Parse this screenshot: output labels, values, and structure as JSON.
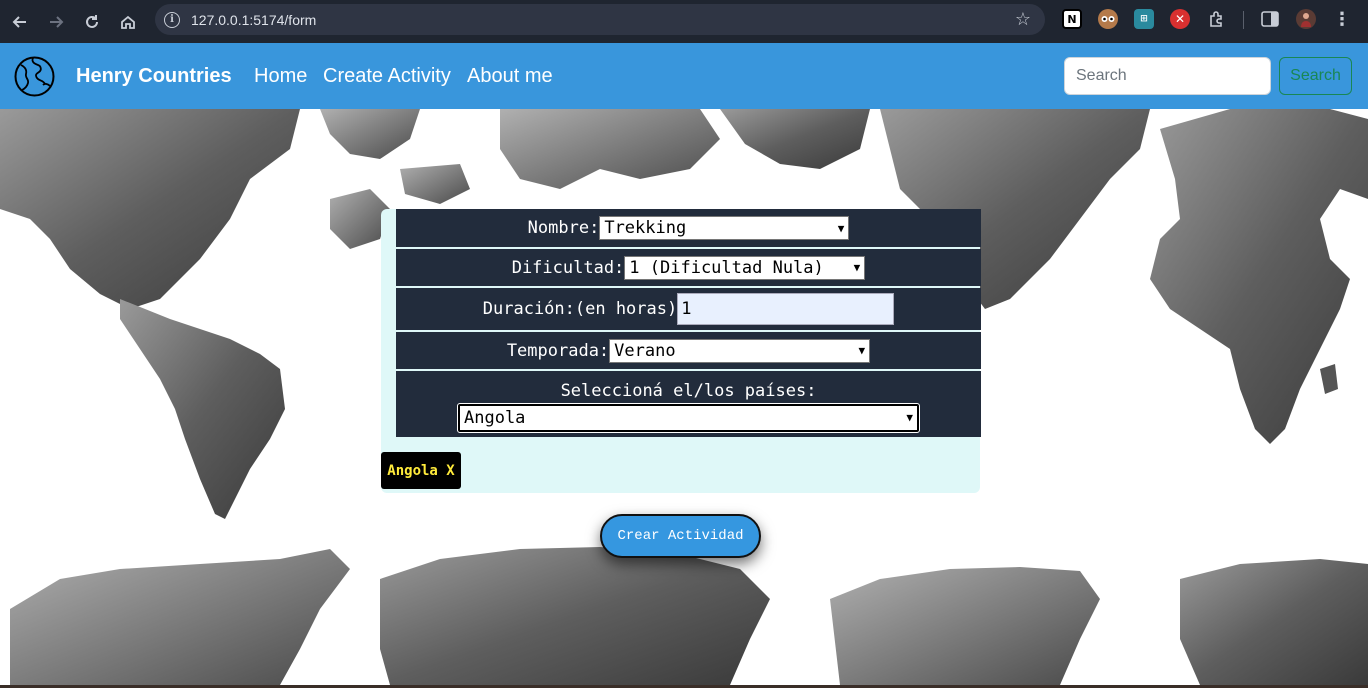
{
  "browser": {
    "url": "127.0.0.1:5174/form",
    "extensions": [
      "notion-icon",
      "owl-icon",
      "puzzle-grid-icon",
      "red-close-icon",
      "extensions-icon",
      "sidepanel-icon",
      "profile-avatar"
    ]
  },
  "navbar": {
    "brand": "Henry Countries",
    "links": [
      "Home",
      "Create Activity",
      "About me"
    ],
    "search_placeholder": "Search",
    "search_button": "Search",
    "bg_color": "#3996dc"
  },
  "form": {
    "nombre": {
      "label": "Nombre:",
      "value": "Trekking"
    },
    "dificultad": {
      "label": "Dificultad:",
      "value": "1 (Dificultad Nula)"
    },
    "duracion": {
      "label": "Duración:(en horas)",
      "value": "1"
    },
    "temporada": {
      "label": "Temporada:",
      "value": "Verano"
    },
    "paises": {
      "label": "Seleccioná el/los países:",
      "value": "Angola"
    },
    "selected_countries": [
      "Angola X"
    ],
    "submit": "Crear Actividad"
  }
}
